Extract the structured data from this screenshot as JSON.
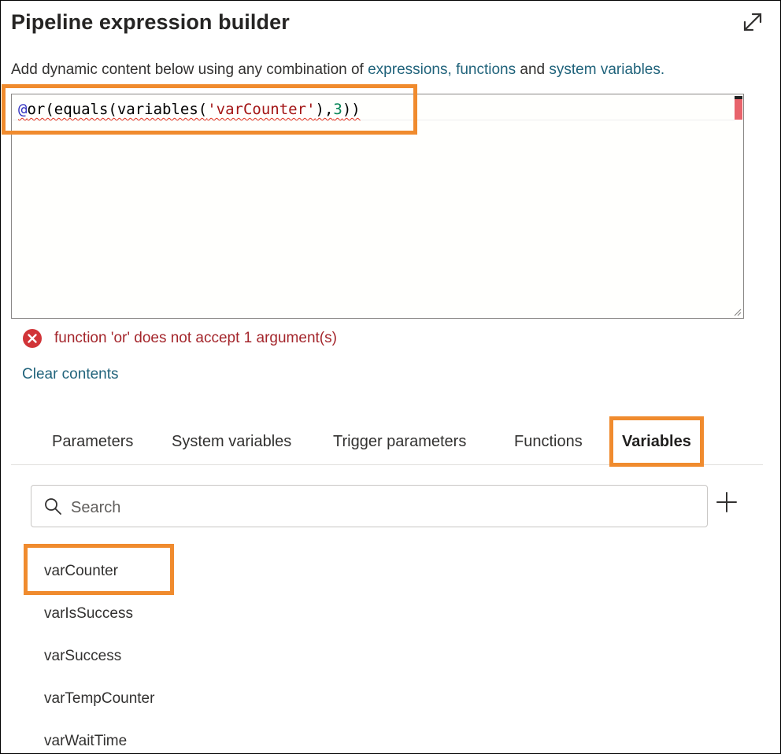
{
  "dialog": {
    "title": "Pipeline expression builder",
    "description": {
      "prefix": "Add dynamic content below using any combination of ",
      "link_expressions": "expressions,",
      "link_functions": "functions",
      "middle": " and ",
      "link_system_variables": "system variables."
    },
    "expand_icon": "expand-diagonal-icon"
  },
  "editor": {
    "code": {
      "at": "@",
      "fn_open": "or(equals(variables(",
      "string": "'varCounter'",
      "comma": "),",
      "number": "3",
      "close": "))"
    }
  },
  "validation": {
    "error_message": "function 'or' does not accept 1 argument(s)",
    "error_icon": "error-circle-icon",
    "error_color": "#a4262c"
  },
  "actions": {
    "clear_contents": "Clear contents"
  },
  "tabs": [
    {
      "label": "Parameters",
      "active": false
    },
    {
      "label": "System variables",
      "active": false
    },
    {
      "label": "Trigger parameters",
      "active": false
    },
    {
      "label": "Functions",
      "active": false
    },
    {
      "label": "Variables",
      "active": true
    }
  ],
  "search": {
    "placeholder": "Search",
    "value": "",
    "add_icon": "plus-icon"
  },
  "variables": [
    "varCounter",
    "varIsSuccess",
    "varSuccess",
    "varTempCounter",
    "varWaitTime"
  ],
  "colors": {
    "highlight": "#f08b2e",
    "link": "#20637b"
  }
}
